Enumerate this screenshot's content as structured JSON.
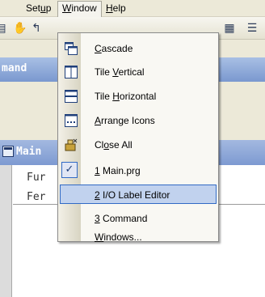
{
  "menubar": {
    "items": [
      {
        "label": "Setup",
        "mnemonic_index": 3
      },
      {
        "label": "Window",
        "mnemonic_index": 0
      },
      {
        "label": "Help",
        "mnemonic_index": 0
      }
    ]
  },
  "command_window": {
    "title": "mand"
  },
  "main_window": {
    "title": "Main",
    "code_lines": [
      "Fur",
      "Fer"
    ]
  },
  "window_menu": {
    "items": [
      {
        "label": "Cascade",
        "icon": "cascade-icon"
      },
      {
        "label": "Tile Vertical",
        "icon": "tile-vertical-icon"
      },
      {
        "label": "Tile Horizontal",
        "icon": "tile-horizontal-icon"
      },
      {
        "label": "Arrange Icons",
        "icon": "arrange-icons-icon"
      },
      {
        "label": "Close All",
        "icon": "close-all-icon"
      },
      {
        "label": "1 Main.prg",
        "checked": true
      },
      {
        "label": "2 I/O Label Editor",
        "highlighted": true
      },
      {
        "label": "3 Command"
      },
      {
        "label": "Windows..."
      }
    ]
  },
  "colors": {
    "menu_highlight": "#c1d2ee",
    "menu_highlight_border": "#316ac5",
    "title_bar": "#7d9ad1"
  }
}
